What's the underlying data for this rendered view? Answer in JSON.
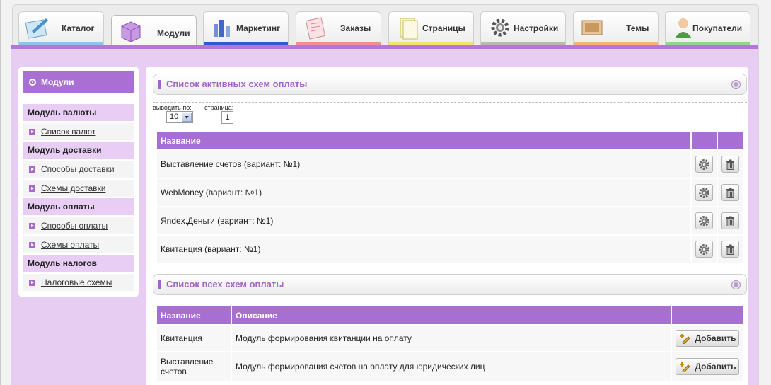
{
  "tabs": [
    {
      "label": "Каталог",
      "icon": "catalog-icon",
      "color": "#8fc3e8"
    },
    {
      "label": "Модули",
      "icon": "modules-icon",
      "color": "#b56bd6",
      "active": true
    },
    {
      "label": "Маркетинг",
      "icon": "marketing-icon",
      "color": "#2f59d3"
    },
    {
      "label": "Заказы",
      "icon": "orders-icon",
      "color": "#ef8e96"
    },
    {
      "label": "Страницы",
      "icon": "pages-icon",
      "color": "#f2e46a"
    },
    {
      "label": "Настройки",
      "icon": "settings-icon",
      "color": "#b8b8b8"
    },
    {
      "label": "Темы",
      "icon": "themes-icon",
      "color": "#f0b37a"
    },
    {
      "label": "Покупатели",
      "icon": "customers-icon",
      "color": "#93d58b"
    }
  ],
  "sidebar": {
    "title": "Модули",
    "groups": [
      {
        "title": "Модуль валюты",
        "items": [
          "Список валют"
        ]
      },
      {
        "title": "Модуль доставки",
        "items": [
          "Способы доставки",
          "Схемы доставки"
        ]
      },
      {
        "title": "Модуль оплаты",
        "items": [
          "Способы оплаты",
          "Схемы оплаты"
        ]
      },
      {
        "title": "Модуль налогов",
        "items": [
          "Налоговые схемы"
        ]
      }
    ]
  },
  "active_section": {
    "title": "Список активных схем оплаты",
    "per_page_label": "выводить по:",
    "per_page_value": "10",
    "page_label": "страница:",
    "page_value": "1",
    "columns": [
      "Название"
    ],
    "rows": [
      "Выставление счетов (вариант: №1)",
      "WebMoney (вариант: №1)",
      "Яndex.Деньги (вариант: №1)",
      "Квитанция (вариант: №1)"
    ]
  },
  "all_section": {
    "title": "Список всех схем оплаты",
    "columns": [
      "Название",
      "Описание"
    ],
    "add_label": "Добавить",
    "rows": [
      {
        "name": "Квитанция",
        "description": "Модуль формирования квитанции на оплату"
      },
      {
        "name": "Выставление счетов",
        "description": "Модуль формирования счетов на оплату для юридических лиц"
      }
    ]
  },
  "colors": {
    "accent": "#a86fd3",
    "header_text": "#a463c7",
    "bg": "#e8cdf3"
  }
}
